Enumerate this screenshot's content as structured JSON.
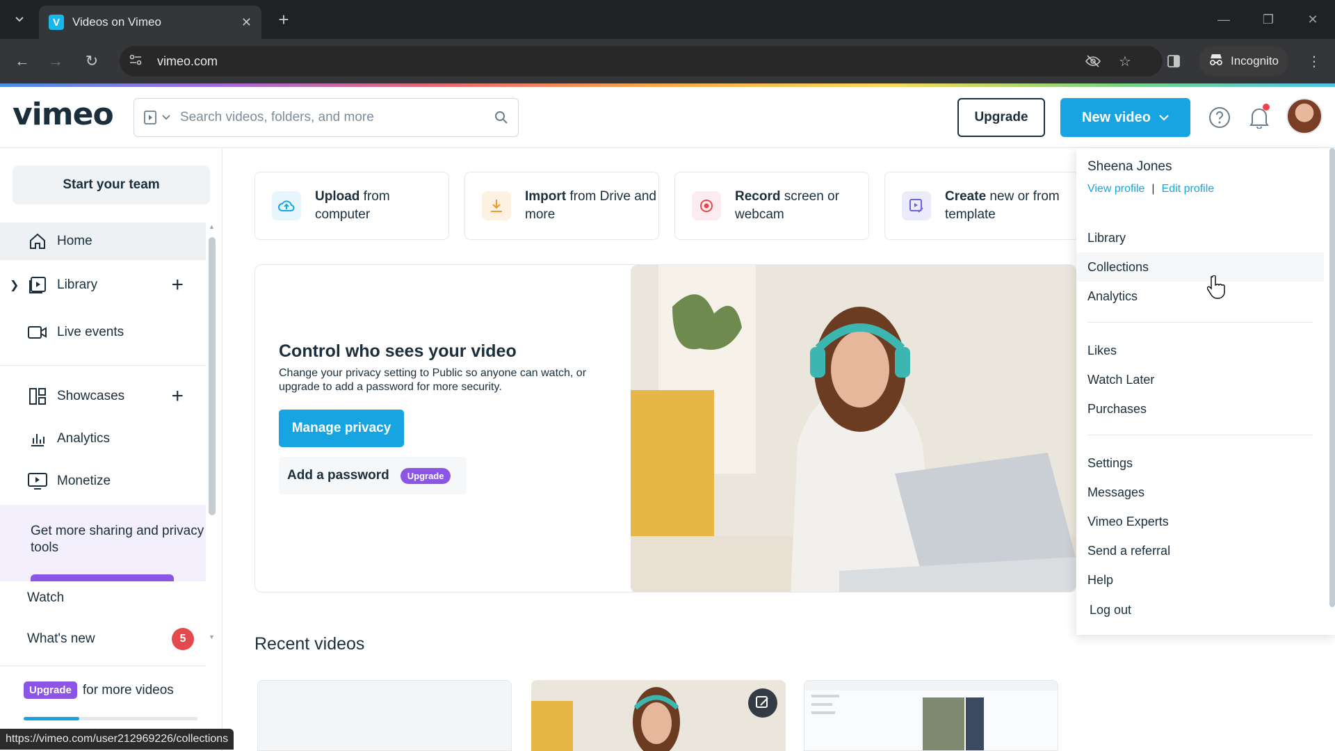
{
  "browser": {
    "tab_title": "Videos on Vimeo",
    "url": "vimeo.com",
    "incognito_label": "Incognito",
    "status_url": "https://vimeo.com/user212969226/collections"
  },
  "header": {
    "logo": "vimeo",
    "search_placeholder": "Search videos, folders, and more",
    "upgrade_label": "Upgrade",
    "new_video_label": "New video"
  },
  "sidebar": {
    "start_team": "Start your team",
    "items": [
      {
        "label": "Home",
        "icon": "home-icon"
      },
      {
        "label": "Library",
        "icon": "library-icon"
      },
      {
        "label": "Live events",
        "icon": "camera-icon"
      },
      {
        "label": "Showcases",
        "icon": "showcases-icon"
      },
      {
        "label": "Analytics",
        "icon": "analytics-icon"
      },
      {
        "label": "Monetize",
        "icon": "monetize-icon"
      }
    ],
    "promo_text": "Get more sharing and privacy tools",
    "watch": "Watch",
    "whats_new": "What's new",
    "whats_new_count": "5",
    "upgrade_badge": "Upgrade",
    "upgrade_text": "for more videos",
    "usage_fraction": 0.32
  },
  "quick_actions": [
    {
      "bold": "Upload",
      "rest": " from computer",
      "icon": "upload-cloud-icon",
      "color": "#e7f5fd"
    },
    {
      "bold": "Import",
      "rest": " from Drive and more",
      "icon": "download-icon",
      "color": "#fdf1e2"
    },
    {
      "bold": "Record",
      "rest": " screen or webcam",
      "icon": "record-icon",
      "color": "#fdecef"
    },
    {
      "bold": "Create",
      "rest": " new or from template",
      "icon": "create-icon",
      "color": "#ecebfb"
    }
  ],
  "hero": {
    "title": "Control who sees your video",
    "body": "Change your privacy setting to Public so anyone can watch, or upgrade to add a password for more security.",
    "manage_btn": "Manage privacy",
    "password_btn": "Add a password",
    "password_badge": "Upgrade"
  },
  "recent": {
    "title": "Recent videos"
  },
  "dropdown": {
    "user_name": "Sheena Jones",
    "view_profile": "View profile",
    "edit_profile": "Edit profile",
    "group1": [
      "Library",
      "Collections",
      "Analytics"
    ],
    "group2": [
      "Likes",
      "Watch Later",
      "Purchases"
    ],
    "group3": [
      "Settings",
      "Messages",
      "Vimeo Experts",
      "Send a referral",
      "Help",
      "Log out"
    ]
  },
  "colors": {
    "accent": "#17a4e2",
    "purple": "#8b55e5",
    "text": "#1a2e3b"
  }
}
